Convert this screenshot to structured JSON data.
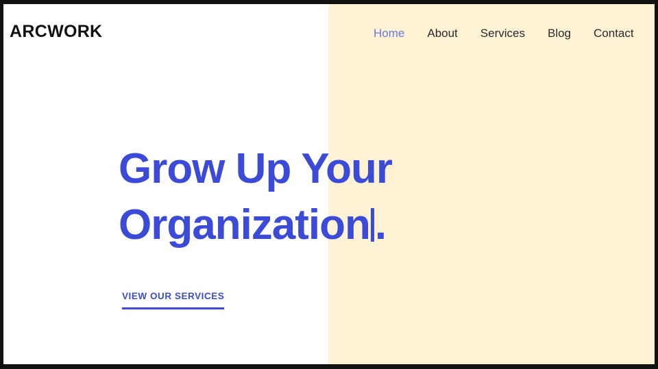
{
  "site": {
    "logo_text": "ARCWORK"
  },
  "nav": {
    "items": [
      {
        "label": "Home",
        "active": true
      },
      {
        "label": "About",
        "active": false
      },
      {
        "label": "Services",
        "active": false
      },
      {
        "label": "Blog",
        "active": false
      },
      {
        "label": "Contact",
        "active": false
      }
    ]
  },
  "hero": {
    "title_line1": "Grow Up Your",
    "title_line2": "Organization",
    "title_suffix": ".",
    "cta_label": "VIEW OUR SERVICES"
  },
  "colors": {
    "accent_blue": "#3b4bd8",
    "nav_active_blue": "#6b77e0",
    "panel_cream": "#fdf2d3",
    "panel_white": "#ffffff",
    "logo_dark": "#111111",
    "nav_text": "#2b2b2b",
    "frame_dark": "#111111"
  }
}
